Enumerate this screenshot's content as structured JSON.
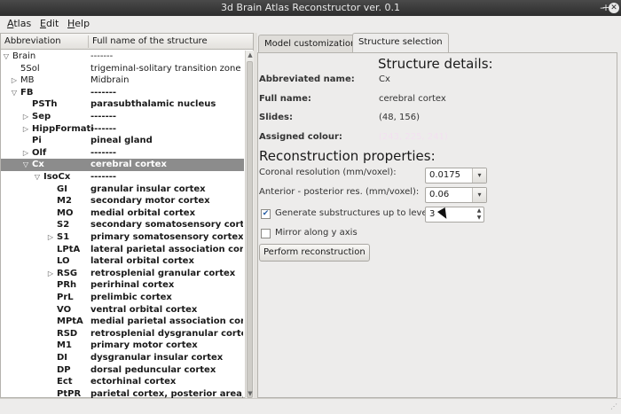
{
  "window": {
    "title": "3d Brain Atlas Reconstructor ver. 0.1"
  },
  "menu": [
    {
      "label": "Atlas",
      "mnemonic": "A",
      "rest": "tlas"
    },
    {
      "label": "Edit",
      "mnemonic": "E",
      "rest": "dit"
    },
    {
      "label": "Help",
      "mnemonic": "H",
      "rest": "elp"
    }
  ],
  "tree": {
    "columns": {
      "abbr": "Abbreviation",
      "full": "Full name of the structure"
    },
    "rows": [
      {
        "abbr": "Brain",
        "full": "-------",
        "level": 0,
        "expand": "open",
        "bold": false
      },
      {
        "abbr": "5Sol",
        "full": "trigeminal-solitary transition zone",
        "level": 1,
        "expand": "none",
        "bold": false
      },
      {
        "abbr": "MB",
        "full": "Midbrain",
        "level": 1,
        "expand": "closed",
        "bold": false
      },
      {
        "abbr": "FB",
        "full": "-------",
        "level": 1,
        "expand": "open",
        "bold": true
      },
      {
        "abbr": "PSTh",
        "full": "parasubthalamic nucleus",
        "level": 2,
        "expand": "none",
        "bold": true
      },
      {
        "abbr": "Sep",
        "full": "-------",
        "level": 2,
        "expand": "closed",
        "bold": true
      },
      {
        "abbr": "HippFormati",
        "full": "-------",
        "level": 2,
        "expand": "closed",
        "bold": true
      },
      {
        "abbr": "Pi",
        "full": "pineal gland",
        "level": 2,
        "expand": "none",
        "bold": true
      },
      {
        "abbr": "Olf",
        "full": "-------",
        "level": 2,
        "expand": "closed",
        "bold": true
      },
      {
        "abbr": "Cx",
        "full": "cerebral cortex",
        "level": 2,
        "expand": "open",
        "bold": true,
        "selected": true
      },
      {
        "abbr": "IsoCx",
        "full": "-------",
        "level": 3,
        "expand": "open",
        "bold": true
      },
      {
        "abbr": "GI",
        "full": "granular insular cortex",
        "level": 4,
        "expand": "none",
        "bold": true
      },
      {
        "abbr": "M2",
        "full": "secondary motor cortex",
        "level": 4,
        "expand": "none",
        "bold": true
      },
      {
        "abbr": "MO",
        "full": "medial orbital cortex",
        "level": 4,
        "expand": "none",
        "bold": true
      },
      {
        "abbr": "S2",
        "full": "secondary somatosensory cortex",
        "level": 4,
        "expand": "none",
        "bold": true
      },
      {
        "abbr": "S1",
        "full": "primary somatosensory cortex",
        "level": 4,
        "expand": "closed",
        "bold": true
      },
      {
        "abbr": "LPtA",
        "full": "lateral parietal association cortex",
        "level": 4,
        "expand": "none",
        "bold": true
      },
      {
        "abbr": "LO",
        "full": "lateral orbital cortex",
        "level": 4,
        "expand": "none",
        "bold": true
      },
      {
        "abbr": "RSG",
        "full": "retrosplenial granular cortex",
        "level": 4,
        "expand": "closed",
        "bold": true
      },
      {
        "abbr": "PRh",
        "full": "perirhinal cortex",
        "level": 4,
        "expand": "none",
        "bold": true
      },
      {
        "abbr": "PrL",
        "full": "prelimbic cortex",
        "level": 4,
        "expand": "none",
        "bold": true
      },
      {
        "abbr": "VO",
        "full": "ventral orbital cortex",
        "level": 4,
        "expand": "none",
        "bold": true
      },
      {
        "abbr": "MPtA",
        "full": "medial parietal association cortex",
        "level": 4,
        "expand": "none",
        "bold": true
      },
      {
        "abbr": "RSD",
        "full": "retrosplenial dysgranular cortex",
        "level": 4,
        "expand": "none",
        "bold": true
      },
      {
        "abbr": "M1",
        "full": "primary motor cortex",
        "level": 4,
        "expand": "none",
        "bold": true
      },
      {
        "abbr": "DI",
        "full": "dysgranular insular cortex",
        "level": 4,
        "expand": "none",
        "bold": true
      },
      {
        "abbr": "DP",
        "full": "dorsal peduncular cortex",
        "level": 4,
        "expand": "none",
        "bold": true
      },
      {
        "abbr": "Ect",
        "full": "ectorhinal cortex",
        "level": 4,
        "expand": "none",
        "bold": true
      },
      {
        "abbr": "PtPR",
        "full": "parietal cortex, posterior area, r",
        "level": 4,
        "expand": "none",
        "bold": true
      }
    ]
  },
  "tabs": [
    {
      "label": "Model customization",
      "active": false
    },
    {
      "label": "Structure selection",
      "active": true
    }
  ],
  "details": {
    "title": "Structure details:",
    "abbr_label": "Abbreviated name:",
    "abbr_value": "Cx",
    "full_label": "Full name:",
    "full_value": "cerebral cortex",
    "slides_label": "Slides:",
    "slides_value": "(48, 156)",
    "colour_label": "Assigned colour:",
    "colour_value": "(243, 225, 241)",
    "colour_hex": "#f3e1f1"
  },
  "reconstruction": {
    "title": "Reconstruction properties:",
    "coronal_label": "Coronal resolution (mm/voxel):",
    "coronal_value": "0.0175",
    "ap_label": "Anterior - posterior res. (mm/voxel):",
    "ap_value": "0.06",
    "substructures_label": "Generate substructures up to level:",
    "substructures_checked": true,
    "substructures_value": "3",
    "mirror_label": "Mirror along y axis",
    "mirror_checked": false,
    "perform_button": "Perform reconstruction"
  }
}
